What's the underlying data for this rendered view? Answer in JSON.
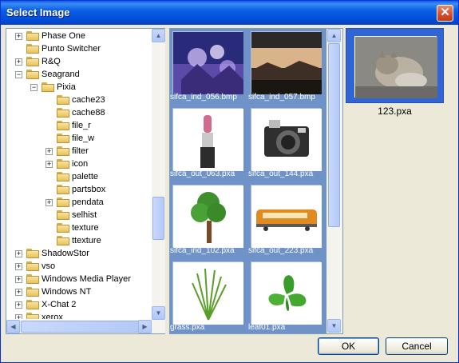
{
  "window": {
    "title": "Select Image"
  },
  "tree": {
    "items": [
      {
        "label": "Phase One",
        "depth": 0,
        "expander": "+"
      },
      {
        "label": "Punto Switcher",
        "depth": 0,
        "expander": ""
      },
      {
        "label": "R&Q",
        "depth": 0,
        "expander": "+"
      },
      {
        "label": "Seagrand",
        "depth": 0,
        "expander": "−"
      },
      {
        "label": "Pixia",
        "depth": 1,
        "expander": "−"
      },
      {
        "label": "cache23",
        "depth": 2,
        "expander": ""
      },
      {
        "label": "cache88",
        "depth": 2,
        "expander": ""
      },
      {
        "label": "file_r",
        "depth": 2,
        "expander": ""
      },
      {
        "label": "file_w",
        "depth": 2,
        "expander": ""
      },
      {
        "label": "filter",
        "depth": 2,
        "expander": "+"
      },
      {
        "label": "icon",
        "depth": 2,
        "expander": "+"
      },
      {
        "label": "palette",
        "depth": 2,
        "expander": ""
      },
      {
        "label": "partsbox",
        "depth": 2,
        "expander": ""
      },
      {
        "label": "pendata",
        "depth": 2,
        "expander": "+"
      },
      {
        "label": "selhist",
        "depth": 2,
        "expander": ""
      },
      {
        "label": "texture",
        "depth": 2,
        "expander": ""
      },
      {
        "label": "ttexture",
        "depth": 2,
        "expander": ""
      },
      {
        "label": "ShadowStor",
        "depth": 0,
        "expander": "+"
      },
      {
        "label": "vso",
        "depth": 0,
        "expander": "+"
      },
      {
        "label": "Windows Media Player",
        "depth": 0,
        "expander": "+"
      },
      {
        "label": "Windows NT",
        "depth": 0,
        "expander": "+"
      },
      {
        "label": "X-Chat 2",
        "depth": 0,
        "expander": "+"
      },
      {
        "label": "xerox",
        "depth": 0,
        "expander": "+"
      }
    ]
  },
  "thumbnails": [
    {
      "name": "sifca_ind_056.bmp",
      "kind": "bubbles"
    },
    {
      "name": "sifca_ind_057.bmp",
      "kind": "landscape"
    },
    {
      "name": "sifca_out_063.pxa",
      "kind": "lipstick"
    },
    {
      "name": "sifca_out_144.pxa",
      "kind": "camera"
    },
    {
      "name": "sifca_ind_102.pxa",
      "kind": "tree"
    },
    {
      "name": "sifca_out_223.pxa",
      "kind": "train"
    },
    {
      "name": "grass.pxa",
      "kind": "grass"
    },
    {
      "name": "leaf01.pxa",
      "kind": "leaf"
    }
  ],
  "preview": {
    "name": "123.pxa",
    "kind": "cat-photo"
  },
  "buttons": {
    "ok": "OK",
    "cancel": "Cancel"
  },
  "colors": {
    "titlebar": "#0a5fe4",
    "selection": "#3165d6",
    "grid_bg": "#6f93c9"
  }
}
